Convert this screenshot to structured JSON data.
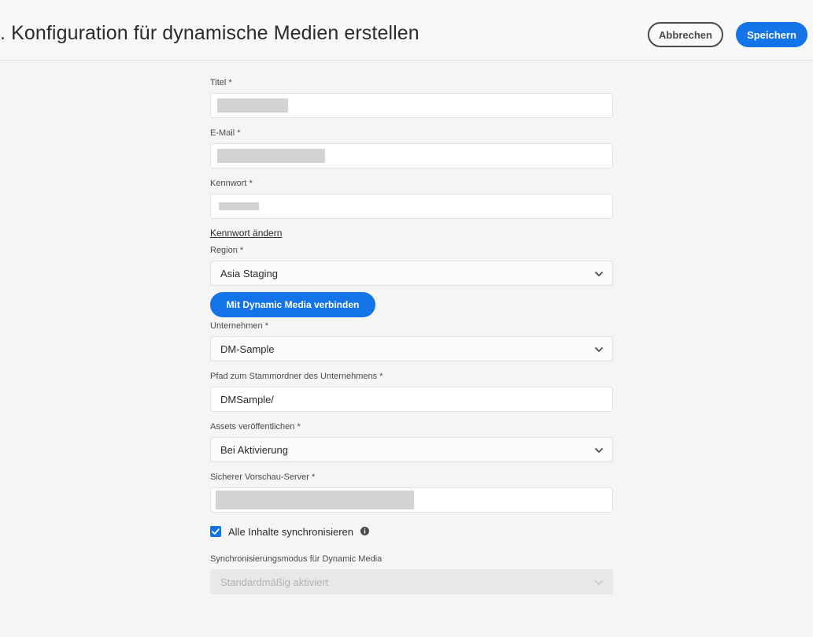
{
  "header": {
    "title": ". Konfiguration für dynamische Medien erstellen",
    "cancel_label": "Abbrechen",
    "save_label": "Speichern"
  },
  "form": {
    "title": {
      "label": "Titel *",
      "value": ""
    },
    "email": {
      "label": "E-Mail *",
      "value": ""
    },
    "password": {
      "label": "Kennwort *",
      "value": ""
    },
    "change_password_link": "Kennwort ändern",
    "region": {
      "label": "Region *",
      "value": "Asia Staging"
    },
    "connect_button": "Mit Dynamic Media verbinden",
    "company": {
      "label": "Unternehmen *",
      "value": "DM-Sample"
    },
    "root_path": {
      "label": "Pfad zum Stammordner des Unternehmens *",
      "value": "DMSample/"
    },
    "publish_assets": {
      "label": "Assets veröffentlichen *",
      "value": "Bei Aktivierung"
    },
    "preview_server": {
      "label": "Sicherer Vorschau-Server *",
      "value": ""
    },
    "sync_all": {
      "label": "Alle Inhalte synchronisieren",
      "checked": true
    },
    "sync_mode": {
      "label": "Synchronisierungsmodus für Dynamic Media",
      "value": "Standardmäßig aktiviert",
      "disabled": true
    }
  },
  "colors": {
    "accent": "#1473e6",
    "background": "#f5f5f5"
  },
  "icons": {
    "dropdown": "chevron-down-icon",
    "checkbox": "checkmark-icon",
    "info": "info-icon"
  }
}
